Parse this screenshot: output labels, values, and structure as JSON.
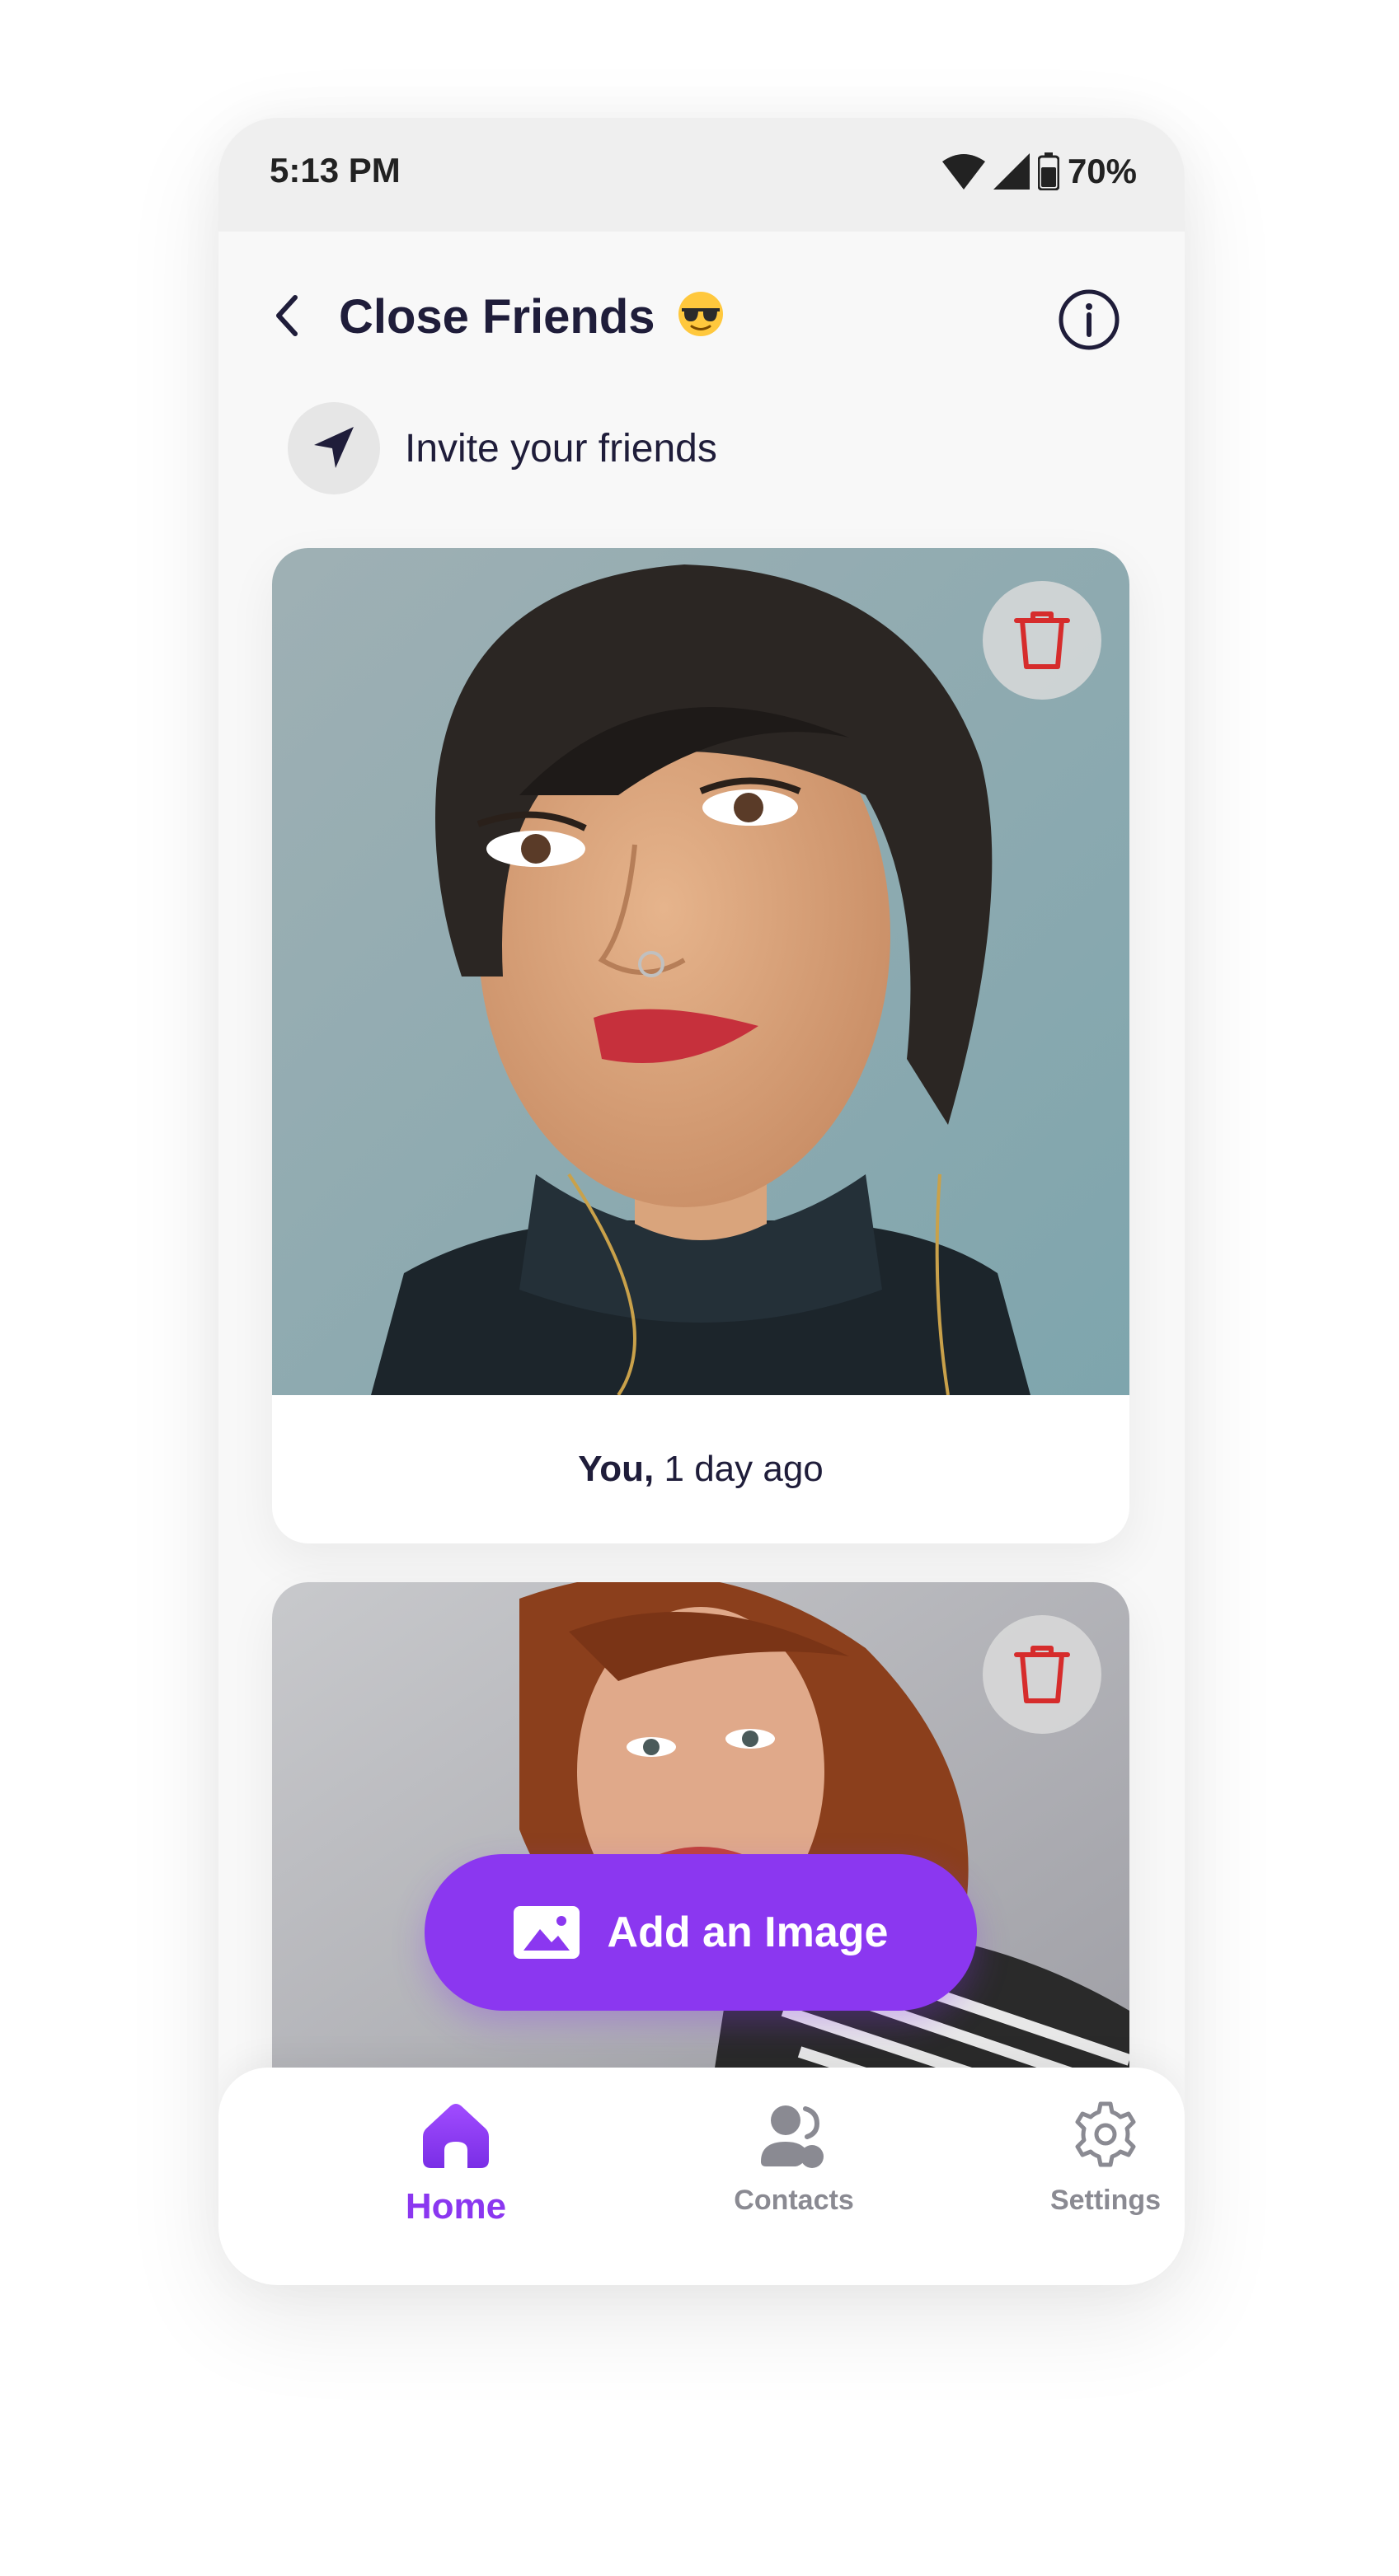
{
  "status_bar": {
    "time": "5:13 PM",
    "battery": "70%"
  },
  "header": {
    "title": "Close Friends",
    "title_emoji": "sunglasses-emoji"
  },
  "invite": {
    "label": "Invite your friends"
  },
  "posts": [
    {
      "author": "You,",
      "time": "1 day ago"
    },
    {
      "author": "",
      "time": ""
    }
  ],
  "add_button": {
    "label": "Add an Image"
  },
  "tabs": [
    {
      "label": "Home",
      "active": true
    },
    {
      "label": "Contacts",
      "active": false
    },
    {
      "label": "Settings",
      "active": false
    }
  ],
  "colors": {
    "accent": "#8b37f0",
    "delete": "#d62c2c",
    "text": "#1f1d3a"
  },
  "icons": [
    "back-icon",
    "info-icon",
    "navigation-arrow-icon",
    "trash-icon",
    "image-icon",
    "home-icon",
    "contacts-icon",
    "gear-icon",
    "wifi-icon",
    "signal-icon",
    "battery-icon"
  ]
}
